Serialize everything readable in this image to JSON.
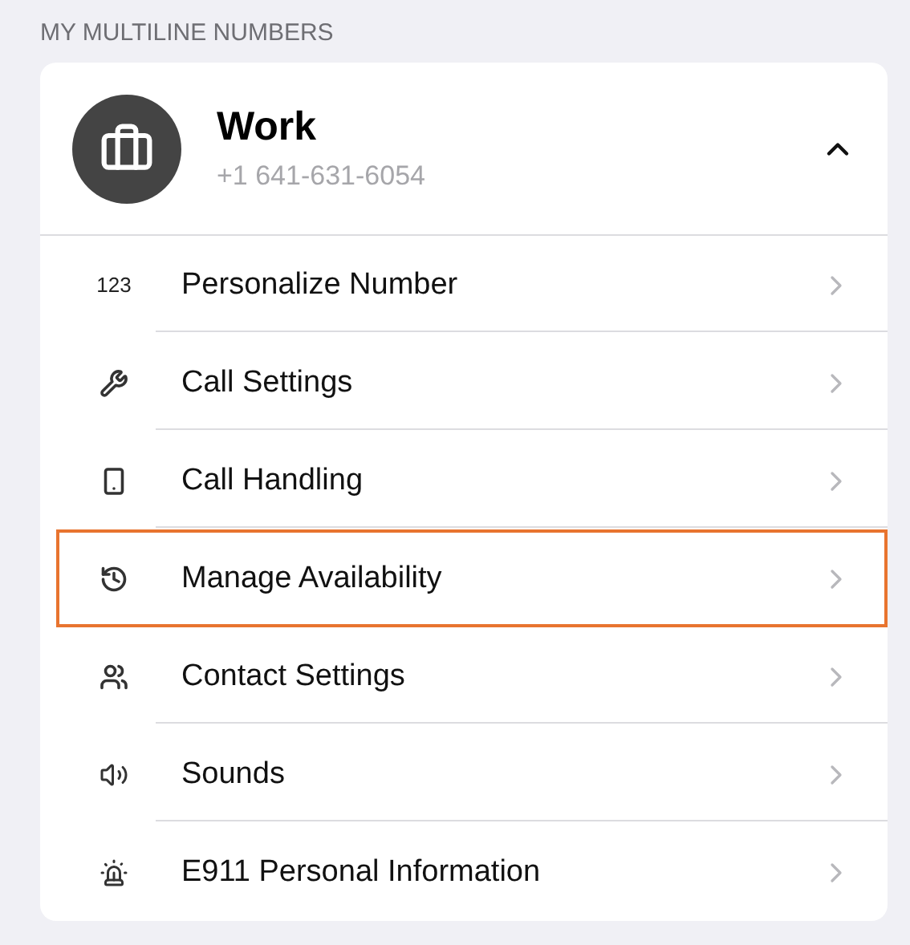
{
  "section_title": "MY MULTILINE NUMBERS",
  "line": {
    "name": "Work",
    "number": "+1 641-631-6054",
    "expanded": true
  },
  "items": [
    {
      "kind": "digits",
      "icon_text": "123",
      "label": "Personalize Number",
      "selected": false
    },
    {
      "kind": "call-settings",
      "label": "Call Settings",
      "selected": false
    },
    {
      "kind": "call-handling",
      "label": "Call Handling",
      "selected": false
    },
    {
      "kind": "availability",
      "label": "Manage Availability",
      "selected": true
    },
    {
      "kind": "contacts",
      "label": "Contact Settings",
      "selected": false
    },
    {
      "kind": "sounds",
      "label": "Sounds",
      "selected": false
    },
    {
      "kind": "alert",
      "label": "E911 Personal Information",
      "selected": false
    }
  ]
}
